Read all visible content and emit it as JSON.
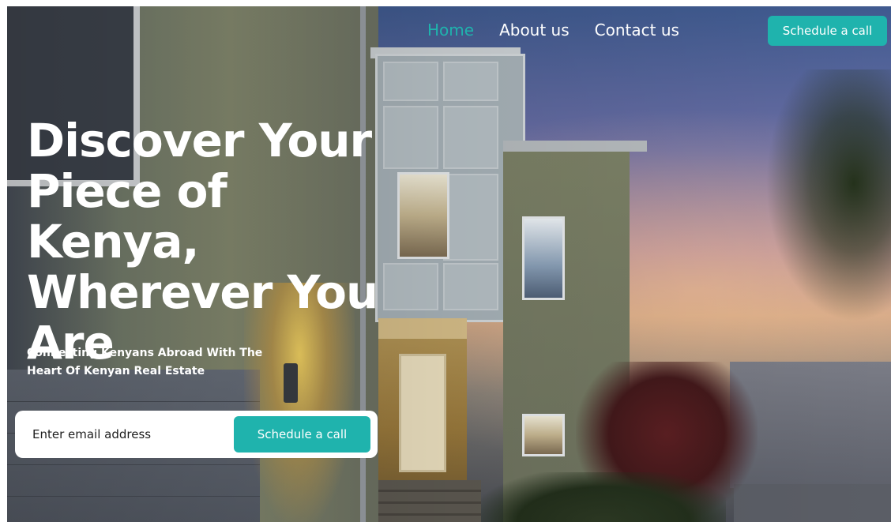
{
  "nav": {
    "links": [
      {
        "label": "Home",
        "active": true
      },
      {
        "label": "About us",
        "active": false
      },
      {
        "label": "Contact us",
        "active": false
      }
    ],
    "cta_label": "Schedule a call"
  },
  "hero": {
    "headline": "Discover Your Piece of Kenya, Wherever You Are",
    "subheadline": "Connecting Kenyans Abroad With The Heart Of Kenyan Real Estate"
  },
  "form": {
    "email_placeholder": "Enter email address",
    "email_value": "",
    "cta_label": "Schedule a call"
  },
  "colors": {
    "accent": "#1fb3ad",
    "text_light": "#ffffff",
    "form_bg": "#ffffff"
  }
}
